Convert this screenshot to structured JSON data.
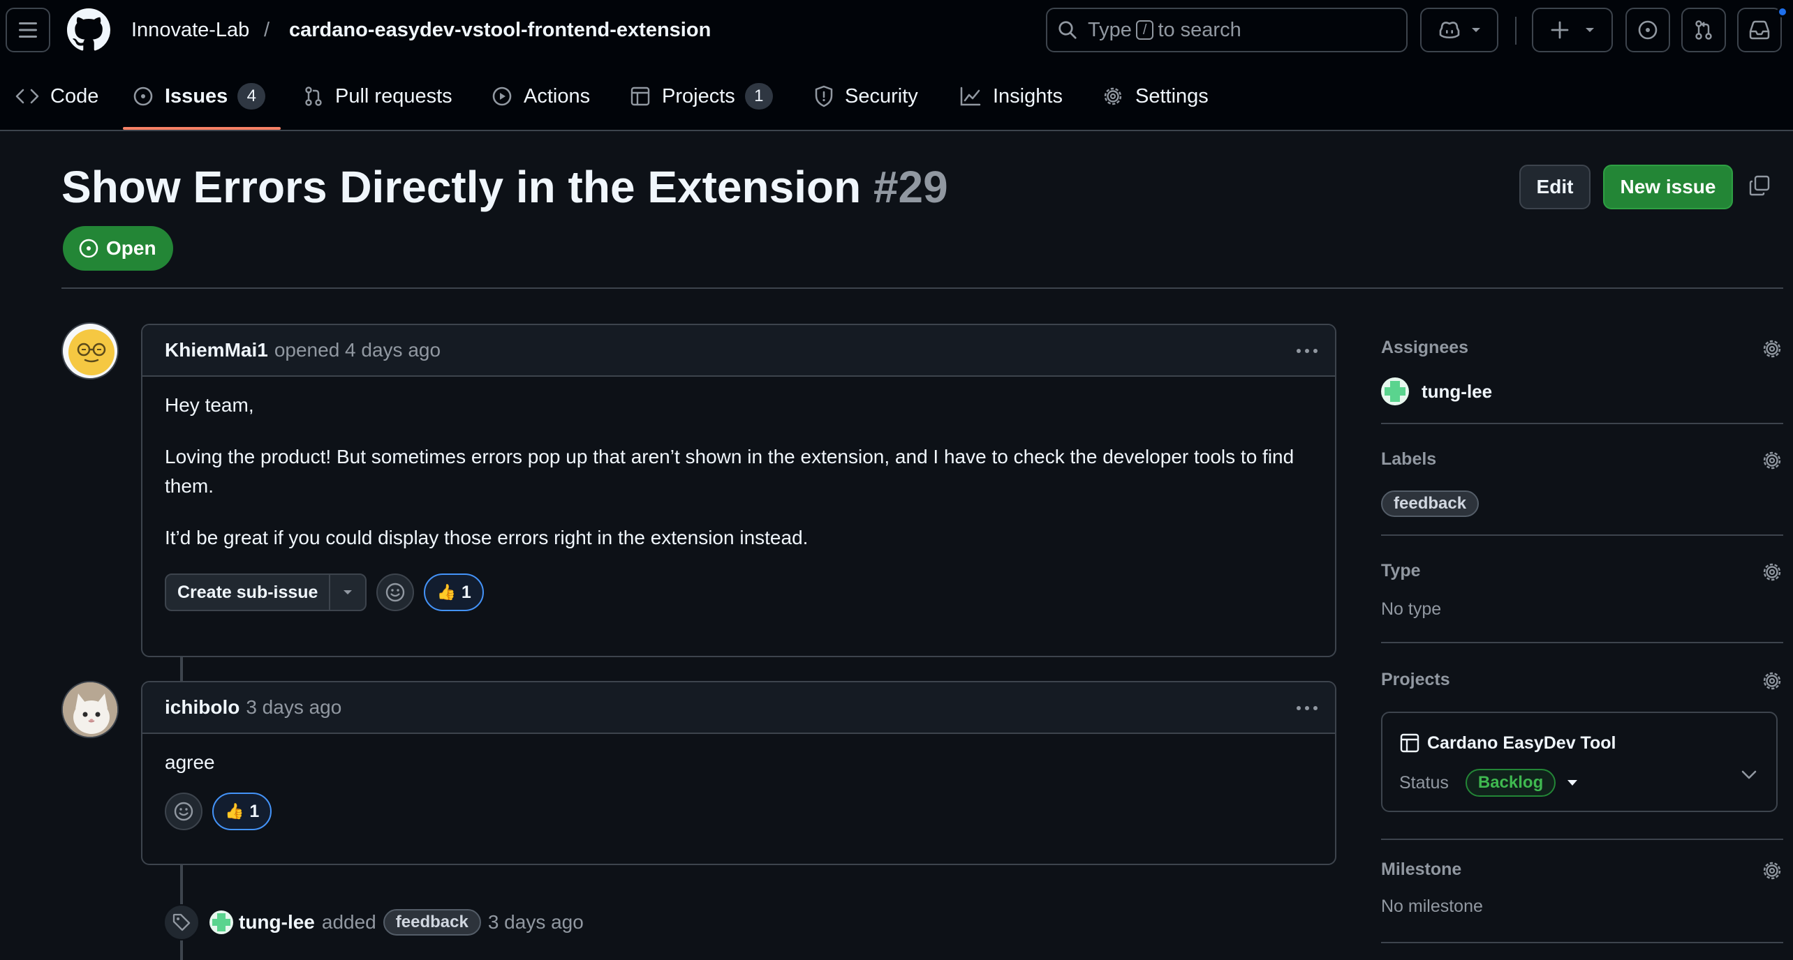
{
  "header": {
    "owner": "Innovate-Lab",
    "separator": "/",
    "repo": "cardano-easydev-vstool-frontend-extension",
    "search_prefix": "Type",
    "search_key": "/",
    "search_suffix": "to search"
  },
  "nav": {
    "code": "Code",
    "issues": "Issues",
    "issues_count": "4",
    "pulls": "Pull requests",
    "actions": "Actions",
    "projects": "Projects",
    "projects_count": "1",
    "security": "Security",
    "insights": "Insights",
    "settings": "Settings"
  },
  "issue": {
    "title": "Show Errors Directly in the Extension",
    "number": "#29",
    "state": "Open",
    "edit_label": "Edit",
    "new_issue_label": "New issue"
  },
  "comments": [
    {
      "author": "KhiemMai1",
      "meta": "opened 4 days ago",
      "paragraphs": [
        "Hey team,",
        "Loving the product! But sometimes errors pop up that aren’t shown in the extension, and I have to check the developer tools to find them.",
        "It’d be great if you could display those errors right in the extension instead."
      ],
      "sub_issue_label": "Create sub-issue",
      "reaction_emoji": "👍",
      "reaction_count": "1"
    },
    {
      "author": "ichibolo",
      "meta": "3 days ago",
      "paragraphs": [
        "agree"
      ],
      "reaction_emoji": "👍",
      "reaction_count": "1"
    }
  ],
  "event": {
    "actor": "tung-lee",
    "action": "added",
    "label": "feedback",
    "time": "3 days ago"
  },
  "sidebar": {
    "assignees_title": "Assignees",
    "assignee": "tung-lee",
    "labels_title": "Labels",
    "label": "feedback",
    "type_title": "Type",
    "type_value": "No type",
    "projects_title": "Projects",
    "project_name": "Cardano EasyDev Tool",
    "status_label": "Status",
    "status_value": "Backlog",
    "milestone_title": "Milestone",
    "milestone_value": "No milestone"
  },
  "colors": {
    "background": "#0d1117",
    "header": "#010409",
    "open_green": "#238636",
    "nav_underline": "#f78166",
    "reaction_blue": "#4493f8"
  }
}
